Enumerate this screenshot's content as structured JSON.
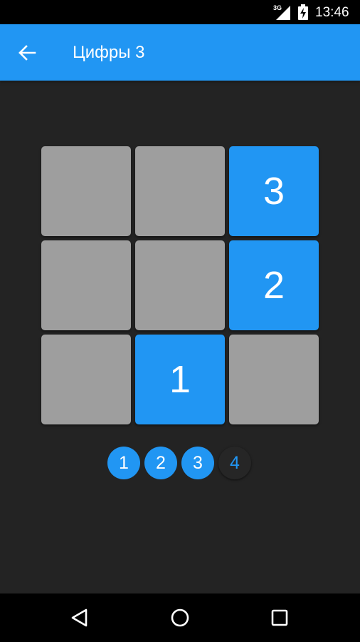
{
  "status_bar": {
    "network": "3G",
    "time": "13:46"
  },
  "app_bar": {
    "title": "Цифры 3",
    "color": "#2196F3"
  },
  "grid": {
    "cells": [
      {
        "label": "",
        "active": false
      },
      {
        "label": "",
        "active": false
      },
      {
        "label": "3",
        "active": true
      },
      {
        "label": "",
        "active": false
      },
      {
        "label": "",
        "active": false
      },
      {
        "label": "2",
        "active": true
      },
      {
        "label": "",
        "active": false
      },
      {
        "label": "1",
        "active": true
      },
      {
        "label": "",
        "active": false
      }
    ]
  },
  "progress": {
    "steps": [
      {
        "label": "1",
        "done": true
      },
      {
        "label": "2",
        "done": true
      },
      {
        "label": "3",
        "done": true
      },
      {
        "label": "4",
        "done": false
      }
    ]
  },
  "colors": {
    "accent": "#2196F3",
    "tile_inactive": "#9E9E9E",
    "background": "#232323"
  }
}
